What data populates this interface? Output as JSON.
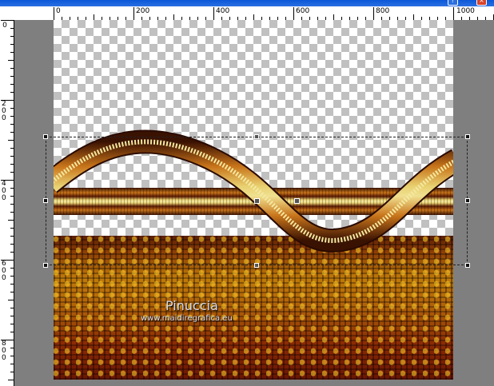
{
  "ruler_top": {
    "labels": [
      "0",
      "200",
      "400",
      "600",
      "800",
      "1000"
    ]
  },
  "ruler_left": {
    "labels": [
      "0",
      "200",
      "400",
      "600",
      "800"
    ]
  },
  "watermark": {
    "name": "Pinuccia",
    "url": "www.maidiregrafica.eu"
  },
  "colors": {
    "workspace": "#7f7f7f",
    "titlebar": "#0a58d8",
    "checker": "#c0c0c0",
    "floor_top": "#5a1e04",
    "floor_mid": "#c07a08",
    "band_light": "#f4e8a0"
  },
  "icons": [
    "help-icon",
    "close-icon"
  ]
}
